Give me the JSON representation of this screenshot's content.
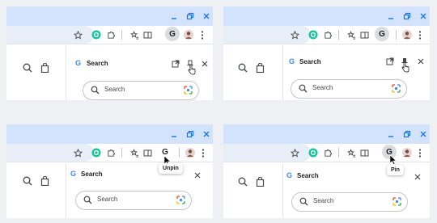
{
  "colors": {
    "titlebar": "#d3e3fd",
    "window_controls": "#1a73e8",
    "icon": "#444746",
    "grammarly": "#15c39a",
    "google_blue": "#4285f4",
    "google_red": "#ea4335",
    "google_yellow": "#fbbc04",
    "google_green": "#34a853"
  },
  "panels": [
    {
      "side_panel_title": "Search",
      "search_placeholder": "Search",
      "toolbar_profile_letter": "G",
      "side_panel_g": "G",
      "tooltip": ""
    },
    {
      "side_panel_title": "Search",
      "search_placeholder": "Search",
      "toolbar_profile_letter": "G",
      "side_panel_g": "G",
      "tooltip": ""
    },
    {
      "side_panel_title": "Search",
      "search_placeholder": "Search",
      "toolbar_profile_letter": "G",
      "side_panel_g": "G",
      "tooltip": "Unpin"
    },
    {
      "side_panel_title": "Search",
      "search_placeholder": "Search",
      "toolbar_profile_letter": "G",
      "side_panel_g": "G",
      "tooltip": "Pin"
    }
  ]
}
